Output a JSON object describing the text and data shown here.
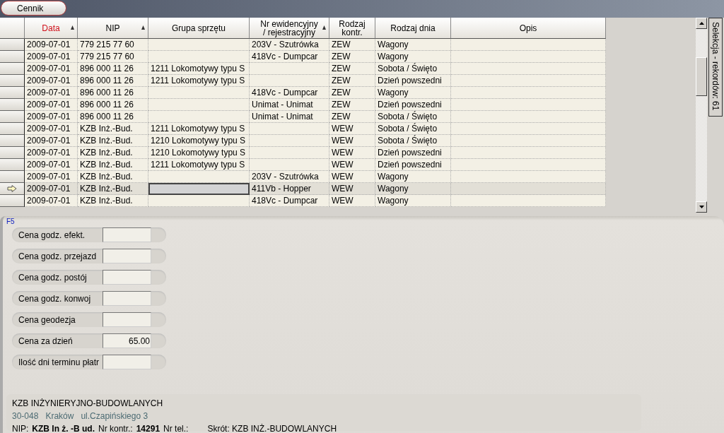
{
  "toolbar": {
    "button": "Cennik"
  },
  "table": {
    "columns": [
      {
        "label": "Data",
        "active": true,
        "sort_arrow": true
      },
      {
        "label": "NIP",
        "active": false,
        "sort_arrow": true
      },
      {
        "label": "Grupa sprzętu",
        "active": false,
        "sort_arrow": false
      },
      {
        "label": "Nr ewidencyjny / rejestracyjny",
        "active": false,
        "sort_arrow": true
      },
      {
        "label": "Rodzaj kontr.",
        "active": false,
        "sort_arrow": false
      },
      {
        "label": "Rodzaj dnia",
        "active": false,
        "sort_arrow": false
      },
      {
        "label": "Opis",
        "active": false,
        "sort_arrow": false
      }
    ],
    "rows": [
      {
        "selected": false,
        "cells": [
          "2009-07-01",
          "779 215 77 60",
          "",
          "203V - Szutrówka",
          "ZEW",
          "Wagony",
          ""
        ]
      },
      {
        "selected": false,
        "cells": [
          "2009-07-01",
          "779 215 77 60",
          "",
          "418Vc - Dumpcar",
          "ZEW",
          "Wagony",
          ""
        ]
      },
      {
        "selected": false,
        "cells": [
          "2009-07-01",
          "896 000 11 26",
          "1211 Lokomotywy typu S",
          "",
          "ZEW",
          "Sobota / Święto",
          ""
        ]
      },
      {
        "selected": false,
        "cells": [
          "2009-07-01",
          "896 000 11 26",
          "1211 Lokomotywy typu S",
          "",
          "ZEW",
          "Dzień powszedni",
          ""
        ]
      },
      {
        "selected": false,
        "cells": [
          "2009-07-01",
          "896 000 11 26",
          "",
          "418Vc - Dumpcar",
          "ZEW",
          "Wagony",
          ""
        ]
      },
      {
        "selected": false,
        "cells": [
          "2009-07-01",
          "896 000 11 26",
          "",
          "Unimat - Unimat",
          "ZEW",
          "Dzień powszedni",
          ""
        ]
      },
      {
        "selected": false,
        "cells": [
          "2009-07-01",
          "896 000 11 26",
          "",
          "Unimat - Unimat",
          "ZEW",
          "Sobota / Święto",
          ""
        ]
      },
      {
        "selected": false,
        "cells": [
          "2009-07-01",
          "KZB Inż.-Bud.",
          "1211 Lokomotywy typu S",
          "",
          "WEW",
          "Sobota / Święto",
          ""
        ]
      },
      {
        "selected": false,
        "cells": [
          "2009-07-01",
          "KZB Inż.-Bud.",
          "1210 Lokomotywy typu S",
          "",
          "WEW",
          "Sobota / Święto",
          ""
        ]
      },
      {
        "selected": false,
        "cells": [
          "2009-07-01",
          "KZB Inż.-Bud.",
          "1210 Lokomotywy typu S",
          "",
          "WEW",
          "Dzień powszedni",
          ""
        ]
      },
      {
        "selected": false,
        "cells": [
          "2009-07-01",
          "KZB Inż.-Bud.",
          "1211 Lokomotywy typu S",
          "",
          "WEW",
          "Dzień powszedni",
          ""
        ]
      },
      {
        "selected": false,
        "cells": [
          "2009-07-01",
          "KZB Inż.-Bud.",
          "",
          "203V - Szutrówka",
          "WEW",
          "Wagony",
          ""
        ]
      },
      {
        "selected": true,
        "cells": [
          "2009-07-01",
          "KZB Inż.-Bud.",
          "",
          "411Vb - Hopper",
          "WEW",
          "Wagony",
          ""
        ]
      },
      {
        "selected": false,
        "cells": [
          "2009-07-01",
          "KZB Inż.-Bud.",
          "",
          "418Vc - Dumpcar",
          "WEW",
          "Wagony",
          ""
        ]
      }
    ]
  },
  "side_tab": "Selekcja - rekordów: 61",
  "form": {
    "hotkey": "F5",
    "fields": [
      {
        "label": "Cena godz. efekt."
      },
      {
        "label": "Cena godz. przejazd"
      },
      {
        "label": "Cena godz. postój"
      },
      {
        "label": "Cena godz. konwoj"
      },
      {
        "label": "Cena geodezja"
      },
      {
        "label": "Cena za dzień",
        "value": "65.00"
      },
      {
        "label": "Ilość dni terminu płatr"
      }
    ]
  },
  "client": {
    "name": "KZB INŻYNIERYJNO-BUDOWLANYCH",
    "address": [
      "30-048",
      "Kraków",
      "ul.Czapińskiego 3"
    ],
    "details": [
      {
        "kind": "pair",
        "label": "NIP:",
        "value": "KZB  In ż. -B ud."
      },
      {
        "kind": "pair",
        "label": "Nr kontr.:",
        "value": "14291"
      },
      {
        "kind": "pair",
        "label": "Nr tel.:"
      },
      {
        "kind": "plain",
        "label": "Skrót: KZB INŻ.-BUDOWLANYCH"
      }
    ]
  }
}
